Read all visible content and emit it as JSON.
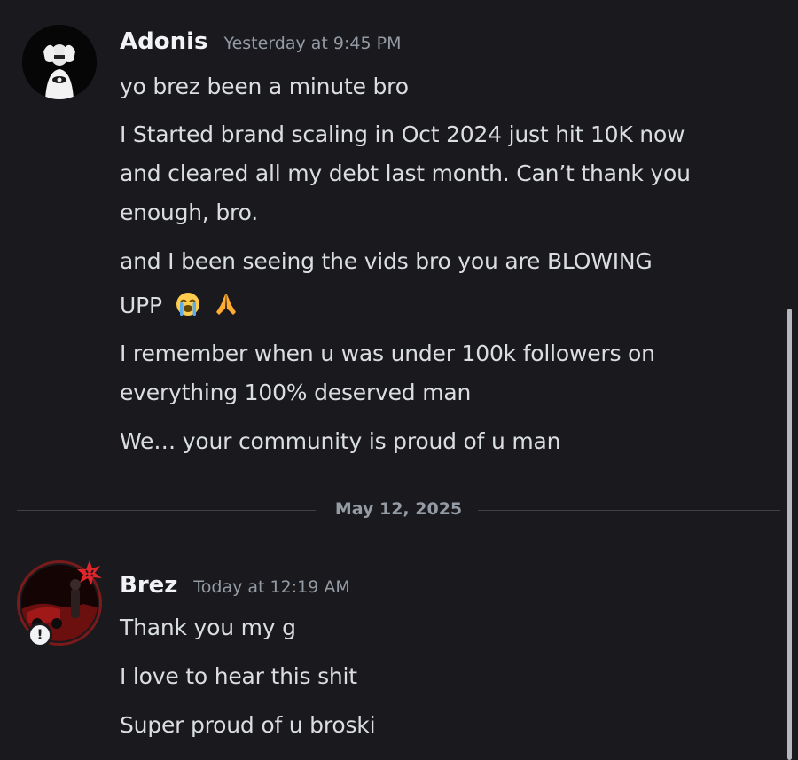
{
  "messages": [
    {
      "author": "Adonis",
      "timestamp": "Yesterday at 9:45 PM",
      "lines": [
        "yo brez been a minute bro",
        "I Started brand scaling in Oct 2024 just hit 10K now",
        "and cleared all my debt last month. Can’t thank you",
        "enough, bro.",
        "and I been seeing the vids bro you are BLOWING",
        "UPP",
        "I remember when u was under 100k followers on",
        "everything 100% deserved man",
        "We… your community is proud of u man"
      ],
      "emojis": [
        "loudly-crying-face-emoji",
        "folded-hands-emoji"
      ]
    },
    {
      "author": "Brez",
      "timestamp": "Today at 12:19 AM",
      "lines": [
        "Thank you my g",
        "I love to hear this shit",
        "Super proud of u broski"
      ]
    }
  ],
  "date_divider": "May 12, 2025",
  "status_badge_symbol": "!",
  "colors": {
    "background": "#1a1a1e",
    "username": "#f2f3f5",
    "timestamp": "#949ba4",
    "message_text": "#dbdee1",
    "divider": "#3f4147"
  }
}
